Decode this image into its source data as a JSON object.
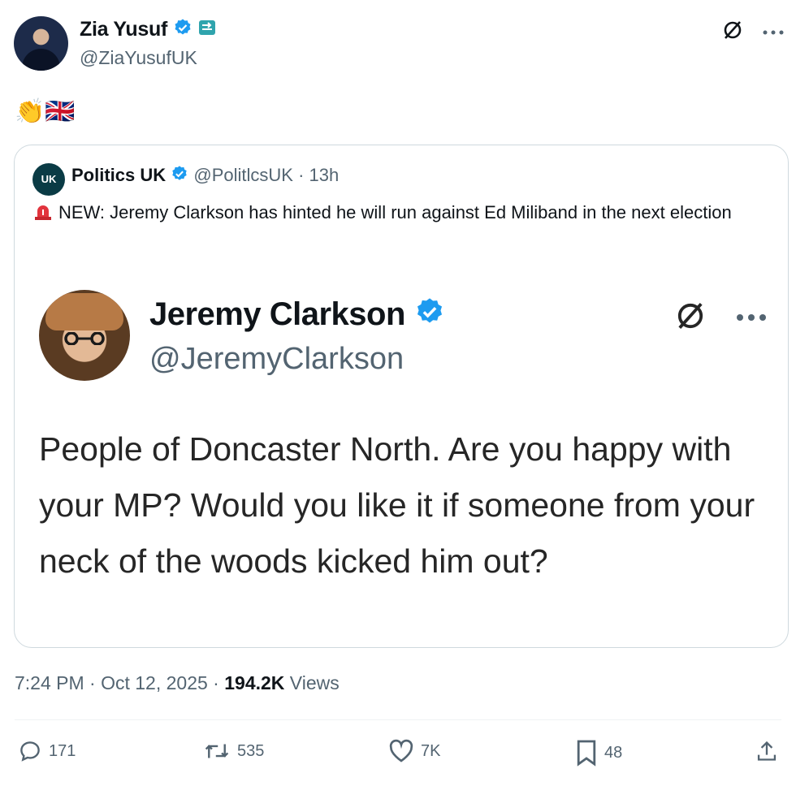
{
  "author": {
    "name": "Zia Yusuf",
    "handle": "@ZiaYusufUK"
  },
  "post": {
    "emoji_text": "👏🇬🇧",
    "timestamp": "7:24 PM · Oct 12, 2025 · ",
    "views_count": "194.2K",
    "views_label": " Views"
  },
  "quoted": {
    "avatar_text": "UK",
    "name": "Politics UK",
    "handle": "@PolitlcsUK",
    "time": " · 13h",
    "text": "NEW: Jeremy Clarkson has hinted he will run against Ed Miliband in the next election",
    "image_tweet": {
      "name": "Jeremy Clarkson",
      "handle": "@JeremyClarkson",
      "text": "People of Doncaster North. Are you happy with your MP? Would you like it if someone from your neck of the woods kicked him out?"
    }
  },
  "actions": {
    "replies": "171",
    "reposts": "535",
    "likes": "7K",
    "bookmarks": "48"
  },
  "colors": {
    "verified": "#1d9bf0",
    "muted": "#536471",
    "text": "#0f1419",
    "border": "#cfd9de"
  },
  "icons": [
    "verified-badge-icon",
    "affiliate-badge-icon",
    "grok-icon",
    "more-icon",
    "siren-icon",
    "reply-icon",
    "repost-icon",
    "like-icon",
    "bookmark-icon",
    "share-icon"
  ]
}
